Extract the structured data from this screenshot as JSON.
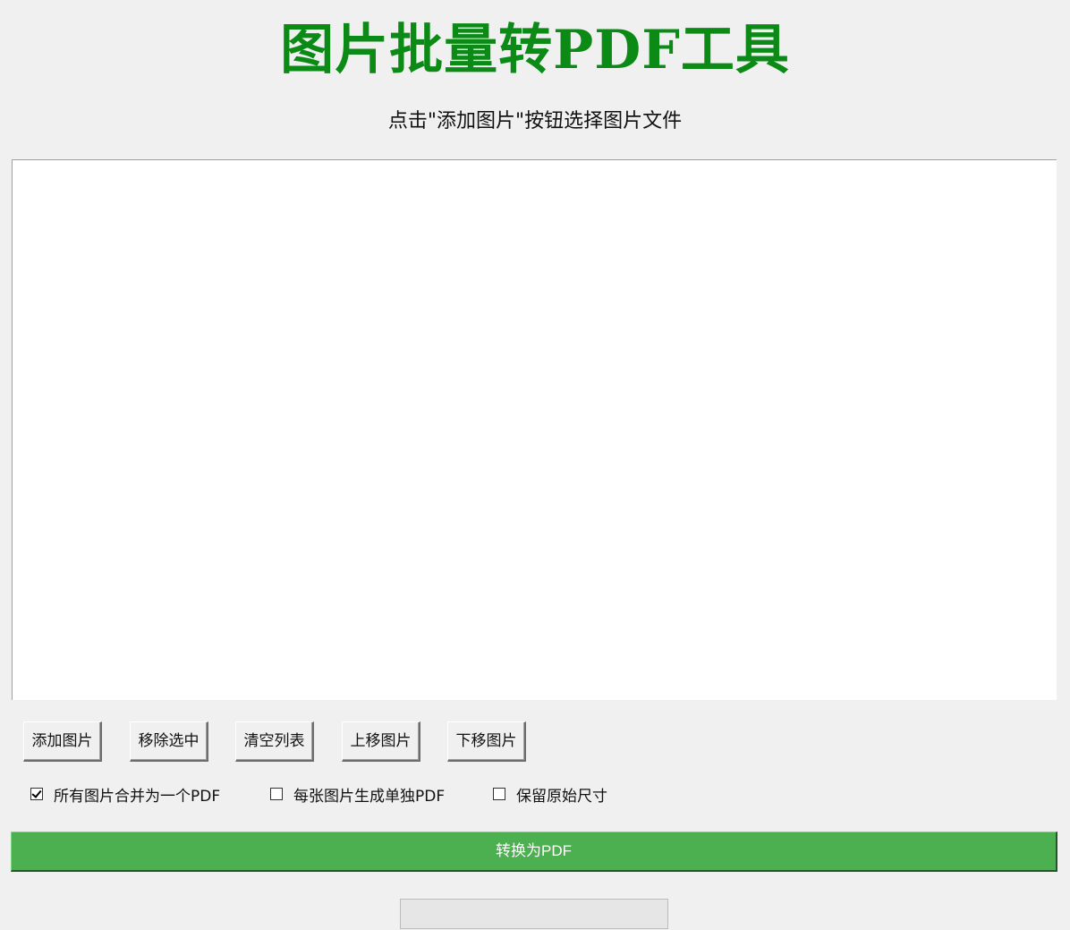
{
  "header": {
    "title": "图片批量转PDF工具",
    "subtitle": "点击\"添加图片\"按钮选择图片文件"
  },
  "file_list": {
    "items": []
  },
  "buttons": {
    "add": "添加图片",
    "remove": "移除选中",
    "clear": "清空列表",
    "move_up": "上移图片",
    "move_down": "下移图片"
  },
  "options": {
    "merge": {
      "label": "所有图片合并为一个PDF",
      "checked": true
    },
    "separate": {
      "label": "每张图片生成单独PDF",
      "checked": false
    },
    "keep_size": {
      "label": "保留原始尺寸",
      "checked": false
    }
  },
  "convert_button": {
    "label": "转换为PDF"
  },
  "progress": {
    "value": 0
  },
  "colors": {
    "title": "#0b8a16",
    "convert_button_bg": "#4caf50",
    "background": "#f0f0f0"
  }
}
